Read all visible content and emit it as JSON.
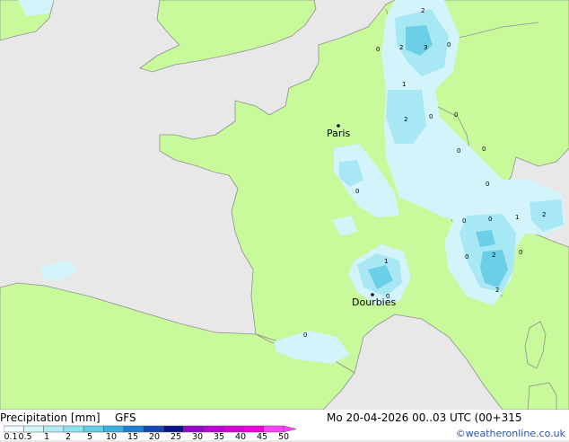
{
  "title": "Precipitation [mm]",
  "model": "GFS",
  "datetime": "Mo 20-04-2026 00..03 UTC (00+315",
  "credit": "©weatheronline.co.uk",
  "cities": [
    {
      "name": "Paris"
    },
    {
      "name": "Dourbies"
    }
  ],
  "contour_labels": [
    "2",
    "2",
    "3",
    "0",
    "0",
    "1",
    "2",
    "0",
    "0",
    "0",
    "0",
    "0",
    "0",
    "0",
    "1",
    "2",
    "0",
    "0",
    "2",
    "2",
    "0",
    "1",
    "0",
    "0"
  ],
  "legend": {
    "ticks": [
      "0.1",
      "0.5",
      "1",
      "2",
      "5",
      "10",
      "15",
      "20",
      "25",
      "30",
      "35",
      "40",
      "45",
      "50"
    ],
    "colors": [
      "#f0fbff",
      "#d2f4fa",
      "#b0ecf5",
      "#8ee2f0",
      "#62cfe6",
      "#3ab0dd",
      "#1e7fd6",
      "#1448b8",
      "#0c168c",
      "#9a00d0",
      "#c000d8",
      "#d800d8",
      "#f000e0",
      "#ff40ff"
    ]
  },
  "colors": {
    "land": "#c8fa9c",
    "sea": "#e8e8e8",
    "border": "#8f8f8f",
    "precip_light": "#d2f4fa",
    "precip_medium": "#a8e8f4",
    "precip_heavy": "#6ccfe8"
  }
}
